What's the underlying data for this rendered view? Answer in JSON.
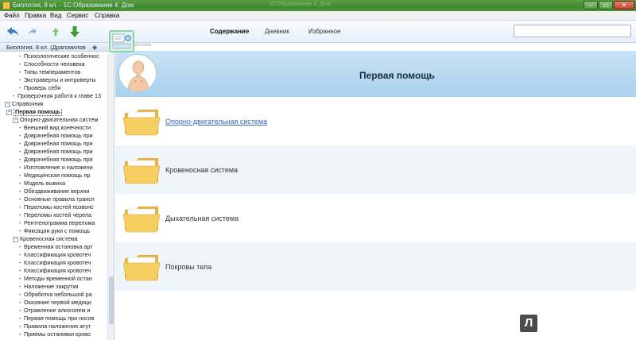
{
  "window": {
    "title": "Биология, 8 кл. - 1С:Образование 4. Дом",
    "ghost_title": "1С:Образование 4. Дом",
    "min_label": "–",
    "max_label": "▭",
    "close_label": "✕"
  },
  "menu": [
    "Файл",
    "Правка",
    "Вид",
    "Сервис",
    "Справка"
  ],
  "toolbar": {
    "tabs": [
      {
        "label": "Содержание",
        "active": true
      },
      {
        "label": "Дневник",
        "active": false
      },
      {
        "label": "Избранное",
        "active": false
      }
    ],
    "search_value": "",
    "icons": [
      "back-arrow-icon",
      "forward-arrow-icon",
      "up-arrow-icon",
      "down-arrow-icon",
      "search-icon"
    ]
  },
  "sidebar": {
    "header": "Биология, 8 кл. (Драгомилов",
    "items": [
      {
        "label": "Психологические особеннос",
        "level": 3
      },
      {
        "label": "Способности человека",
        "level": 3
      },
      {
        "label": "Типы темпераментов",
        "level": 3
      },
      {
        "label": "Экстраверты и интроверты",
        "level": 3
      },
      {
        "label": "Проверь себя",
        "level": 3
      },
      {
        "label": "Проверочная работа к главе 13",
        "level": 2
      },
      {
        "label": "Справочник",
        "level": 0,
        "expander": "−"
      },
      {
        "label": "Первая помощь",
        "level": 1,
        "expander": "−",
        "selected": true
      },
      {
        "label": "Опорно-двигательная систем",
        "level": 2,
        "expander": "−"
      },
      {
        "label": "Внешний вид конечности",
        "level": 3
      },
      {
        "label": "Доврачебная помощь при",
        "level": 3
      },
      {
        "label": "Доврачебная помощь при",
        "level": 3
      },
      {
        "label": "Доврачебная помощь при",
        "level": 3
      },
      {
        "label": "Доврачебная помощь при",
        "level": 3
      },
      {
        "label": "Изготовление и наложени",
        "level": 3
      },
      {
        "label": "Медицинская помощь пр",
        "level": 3
      },
      {
        "label": "Модель вывиха",
        "level": 3
      },
      {
        "label": "Обездвиживание верхни",
        "level": 3
      },
      {
        "label": "Основные правила трансп",
        "level": 3
      },
      {
        "label": "Переломы костей позвонс",
        "level": 3
      },
      {
        "label": "Переломы костей черепа",
        "level": 3
      },
      {
        "label": "Рентгенограмма перелома",
        "level": 3
      },
      {
        "label": "Фиксация руки с помощь",
        "level": 3
      },
      {
        "label": "Кровеносная система",
        "level": 2,
        "expander": "−"
      },
      {
        "label": "Временная остановка арт",
        "level": 3
      },
      {
        "label": "Классификация кровотеч",
        "level": 3
      },
      {
        "label": "Классификация кровотеч",
        "level": 3
      },
      {
        "label": "Классификация кровотеч",
        "level": 3
      },
      {
        "label": "Методы временной остан",
        "level": 3
      },
      {
        "label": "Наложение закрутки",
        "level": 3
      },
      {
        "label": "Обработка небольшой ра",
        "level": 3
      },
      {
        "label": "Оказание первой медици",
        "level": 3
      },
      {
        "label": "Отравление алкоголем и",
        "level": 3
      },
      {
        "label": "Первая помощь при носов",
        "level": 3
      },
      {
        "label": "Правила наложения жгут",
        "level": 3
      },
      {
        "label": "Приемы остановки крово",
        "level": 3
      }
    ]
  },
  "main": {
    "breadcrumb": "Справочник",
    "title": "Первая помощь",
    "rows": [
      {
        "label": "Опорно-двигательная система",
        "link": true
      },
      {
        "label": "Кровеносная система",
        "link": false
      },
      {
        "label": "Дыхательная система",
        "link": false
      },
      {
        "label": "Покровы тела",
        "link": false
      }
    ]
  },
  "watermark": "Л",
  "colors": {
    "titlebar": "#4a9638",
    "header_band": "#b8daf2",
    "link": "#3b64b0",
    "folder": "#f3c95a"
  }
}
